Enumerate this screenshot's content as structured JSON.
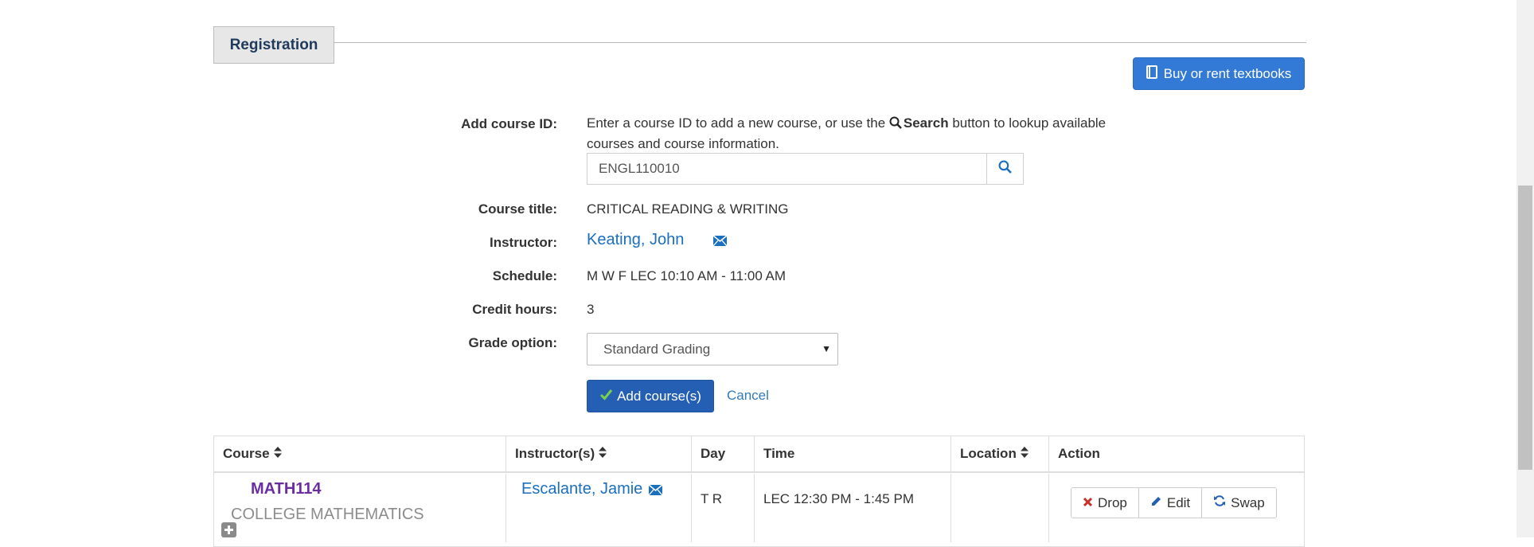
{
  "section": {
    "title": "Registration"
  },
  "textbook_button": {
    "label": "Buy or rent textbooks",
    "icon": "book-icon"
  },
  "form": {
    "add_course_label": "Add course ID:",
    "help_text_before": "Enter a course ID to add a new course, or use the",
    "help_text_search": "Search",
    "help_text_after": "button to lookup available courses and course information.",
    "course_id_value": "ENGL110010",
    "course_title_label": "Course title:",
    "course_title_value": "CRITICAL READING & WRITING",
    "instructor_label": "Instructor:",
    "instructor_value": "Keating, John",
    "schedule_label": "Schedule:",
    "schedule_value": "M W F LEC 10:10 AM - 11:00 AM",
    "credit_hours_label": "Credit hours:",
    "credit_hours_value": "3",
    "grade_option_label": "Grade option:",
    "grade_option_value": "Standard Grading",
    "add_button_label": "Add course(s)",
    "cancel_label": "Cancel"
  },
  "table": {
    "headers": [
      "Course",
      "Instructor(s)",
      "Day",
      "Time",
      "Location",
      "Action"
    ],
    "rows": [
      {
        "course_code": "MATH114",
        "course_name": "COLLEGE MATHEMATICS",
        "instructor": "Escalante, Jamie",
        "day": "T R",
        "time": "LEC 12:30 PM - 1:45 PM",
        "location": "",
        "actions": [
          "Drop",
          "Edit",
          "Swap"
        ]
      }
    ]
  },
  "colors": {
    "primary_blue": "#337ad6",
    "dark_blue_button": "#245fb4",
    "link_blue": "#1a6fbf",
    "course_purple": "#6a2ea1",
    "drop_red": "#c9302c"
  }
}
